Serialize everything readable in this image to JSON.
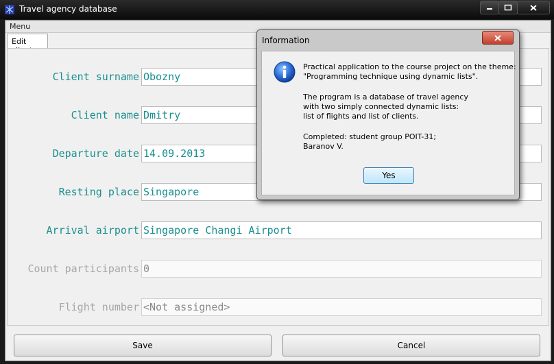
{
  "window": {
    "title": "Travel agency database",
    "controls": [
      "minimize-icon",
      "maximize-icon",
      "close-icon"
    ]
  },
  "menu": {
    "label": "Menu"
  },
  "tab": {
    "label": "Edit client"
  },
  "form": {
    "fields": [
      {
        "label": "Client surname",
        "value": "Obozny",
        "enabled": true
      },
      {
        "label": "Client name",
        "value": "Dmitry",
        "enabled": true
      },
      {
        "label": "Departure date",
        "value": "14.09.2013",
        "enabled": true
      },
      {
        "label": "Resting place",
        "value": "Singapore",
        "enabled": true
      },
      {
        "label": "Arrival airport",
        "value": "Singapore Changi Airport",
        "enabled": true
      },
      {
        "label": "Count participants",
        "value": "0",
        "enabled": false
      },
      {
        "label": "Flight number",
        "value": "<Not assigned>",
        "enabled": false
      }
    ]
  },
  "buttons": {
    "save": "Save",
    "cancel": "Cancel"
  },
  "dialog": {
    "title": "Information",
    "icon": "info-icon",
    "lines": [
      "Practical application to the course project on the theme:",
      "\"Programming technique using dynamic lists\".",
      "The program is a database of travel agency",
      "with two simply connected dynamic lists:",
      "list of flights and list of clients.",
      "Completed: student group POIT-31;",
      "Baranov V."
    ],
    "yes_label": "Yes"
  },
  "colors": {
    "label_text": "#1a8f8f",
    "disabled_text": "#a6a6a6",
    "title_bar": "#0b0b0b",
    "close_button": "#c1402c"
  }
}
